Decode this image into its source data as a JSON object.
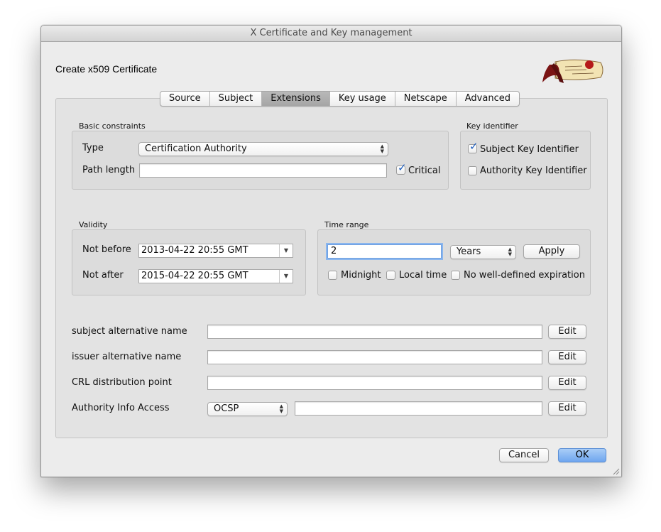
{
  "window": {
    "title": "X Certificate and Key management"
  },
  "dialog": {
    "heading": "Create x509 Certificate"
  },
  "tabs": [
    {
      "label": "Source",
      "selected": false
    },
    {
      "label": "Subject",
      "selected": false
    },
    {
      "label": "Extensions",
      "selected": true
    },
    {
      "label": "Key usage",
      "selected": false
    },
    {
      "label": "Netscape",
      "selected": false
    },
    {
      "label": "Advanced",
      "selected": false
    }
  ],
  "basic_constraints": {
    "group_label": "Basic constraints",
    "type_label": "Type",
    "type_value": "Certification Authority",
    "path_length_label": "Path length",
    "path_length_value": "",
    "critical_label": "Critical",
    "critical_checked": true
  },
  "key_identifier": {
    "group_label": "Key identifier",
    "subject_label": "Subject Key Identifier",
    "subject_checked": true,
    "authority_label": "Authority Key Identifier",
    "authority_checked": false
  },
  "validity": {
    "group_label": "Validity",
    "not_before_label": "Not before",
    "not_before_value": "2013-04-22 20:55 GMT",
    "not_after_label": "Not after",
    "not_after_value": "2015-04-22 20:55 GMT"
  },
  "time_range": {
    "group_label": "Time range",
    "amount": "2",
    "unit": "Years",
    "apply_label": "Apply",
    "midnight_label": "Midnight",
    "local_time_label": "Local time",
    "no_expiration_label": "No well-defined expiration"
  },
  "alt_names": {
    "subject_alt_label": "subject alternative name",
    "issuer_alt_label": "issuer alternative name",
    "crl_label": "CRL distribution point",
    "aia_label": "Authority Info Access",
    "aia_method": "OCSP",
    "edit_label": "Edit"
  },
  "footer": {
    "cancel_label": "Cancel",
    "ok_label": "OK"
  }
}
